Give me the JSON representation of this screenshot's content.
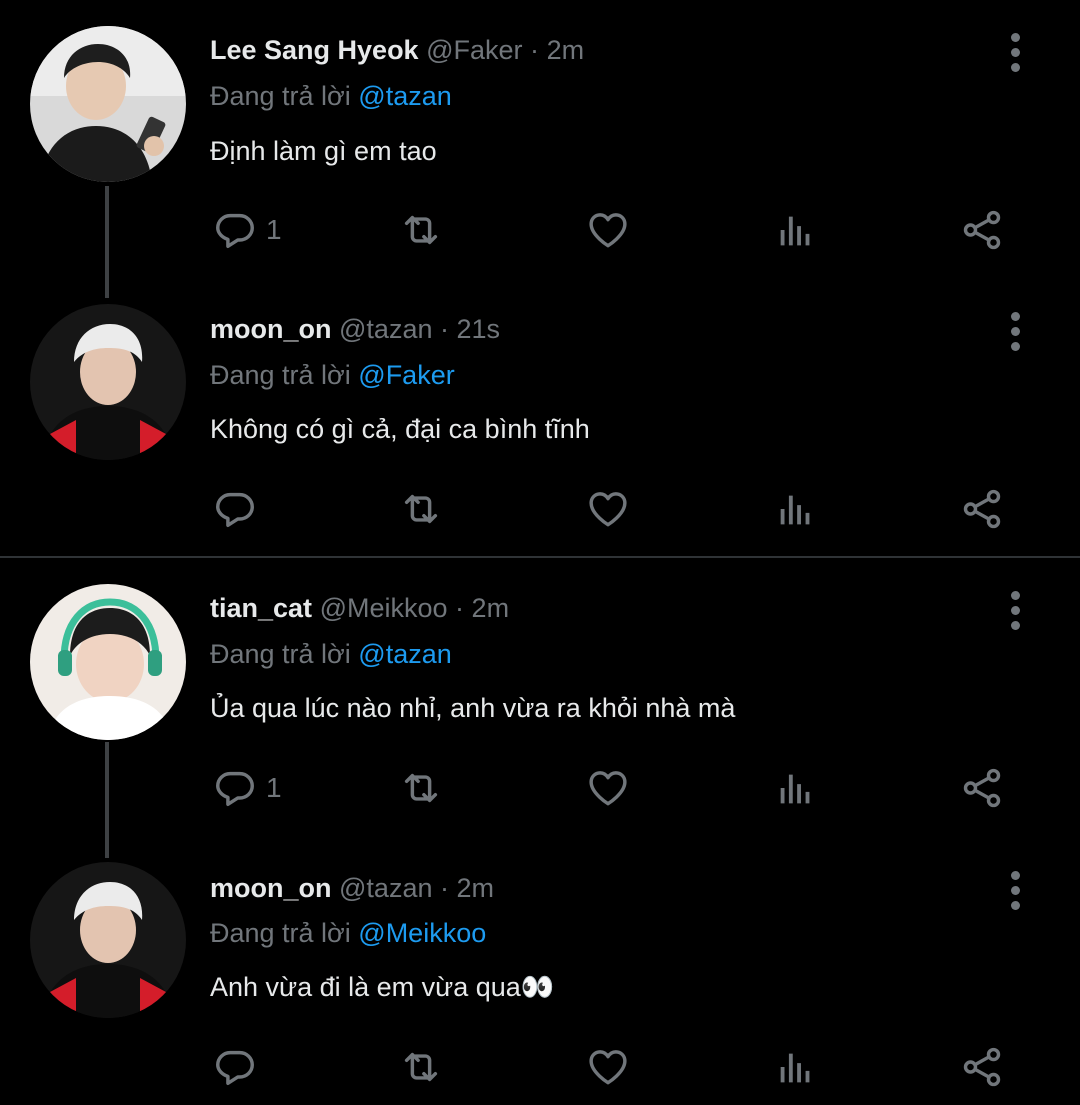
{
  "tweets": [
    {
      "name": "Lee Sang Hyeok",
      "handle": "@Faker",
      "sep": "·",
      "time": "2m",
      "reply_prefix": "Đang trả lời",
      "reply_to": "@tazan",
      "text": "Định làm gì em tao",
      "reply_count": "1"
    },
    {
      "name": "moon_on",
      "handle": "@tazan",
      "sep": "·",
      "time": "21s",
      "reply_prefix": "Đang trả lời",
      "reply_to": "@Faker",
      "text": "Không có gì cả, đại ca bình tĩnh",
      "reply_count": ""
    },
    {
      "name": "tian_cat",
      "handle": "@Meikkoo",
      "sep": "·",
      "time": "2m",
      "reply_prefix": "Đang trả lời",
      "reply_to": "@tazan",
      "text": "Ủa qua lúc nào nhỉ, anh vừa ra khỏi nhà mà",
      "reply_count": "1"
    },
    {
      "name": "moon_on",
      "handle": "@tazan",
      "sep": "·",
      "time": "2m",
      "reply_prefix": "Đang trả lời",
      "reply_to": "@Meikkoo",
      "text": "Anh vừa đi là em vừa qua👀",
      "reply_count": ""
    }
  ],
  "icons": {
    "reply": "reply-icon",
    "retweet": "retweet-icon",
    "like": "heart-icon",
    "views": "views-icon",
    "share": "share-icon",
    "more": "more-vertical-icon"
  },
  "colors": {
    "background": "#000000",
    "text": "#e7e9ea",
    "muted": "#71767b",
    "mention": "#1d9bf0",
    "divider": "#2f3336"
  }
}
